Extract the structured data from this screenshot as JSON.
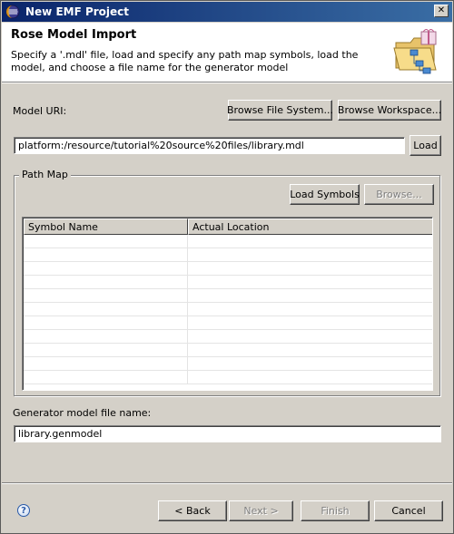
{
  "window": {
    "title": "New EMF Project",
    "close_glyph": "✕"
  },
  "banner": {
    "title": "Rose Model Import",
    "description": "Specify a '.mdl' file, load and specify any path map symbols, load the model, and choose a file name for the generator model",
    "icon": "wizard-folder-icon"
  },
  "model_uri": {
    "label": "Model URI:",
    "browse_fs_label": "Browse File System...",
    "browse_ws_label": "Browse Workspace...",
    "value": "platform:/resource/tutorial%20source%20files/library.mdl",
    "load_label": "Load"
  },
  "path_map": {
    "group_label": "Path Map",
    "load_symbols_label": "Load Symbols",
    "browse_label": "Browse...",
    "columns": [
      "Symbol Name",
      "Actual Location"
    ],
    "rows": []
  },
  "generator": {
    "label": "Generator model file name:",
    "value": "library.genmodel"
  },
  "footer": {
    "help_glyph": "?",
    "back_label": "< Back",
    "next_label": "Next >",
    "finish_label": "Finish",
    "cancel_label": "Cancel"
  },
  "colors": {
    "titlebar_start": "#0a246a",
    "titlebar_end": "#3a6ea5",
    "dialog_bg": "#d4d0c8"
  }
}
